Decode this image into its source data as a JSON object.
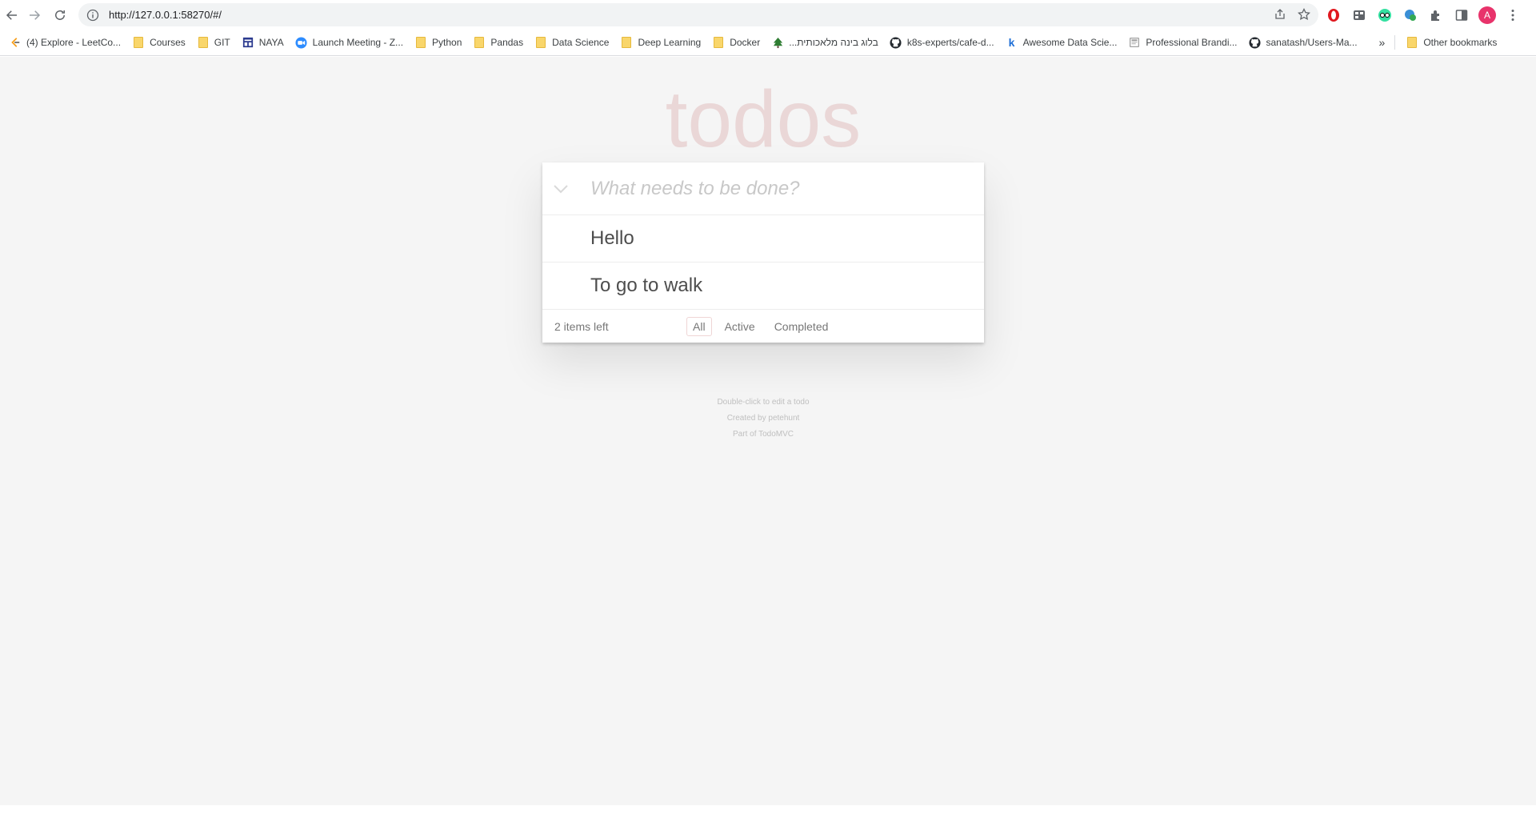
{
  "browser": {
    "url": "http://127.0.0.1:58270/#/",
    "avatar_letter": "A",
    "bookmarks": [
      {
        "label": "(4) Explore - LeetCo...",
        "icon": "leetcode-icon"
      },
      {
        "label": "Courses",
        "icon": "folder-icon"
      },
      {
        "label": "GIT",
        "icon": "folder-icon"
      },
      {
        "label": "NAYA",
        "icon": "naya-icon"
      },
      {
        "label": "Launch Meeting - Z...",
        "icon": "zoom-icon"
      },
      {
        "label": "Python",
        "icon": "folder-icon"
      },
      {
        "label": "Pandas",
        "icon": "folder-icon"
      },
      {
        "label": "Data Science",
        "icon": "folder-icon"
      },
      {
        "label": "Deep Learning",
        "icon": "folder-icon"
      },
      {
        "label": "Docker",
        "icon": "folder-icon"
      },
      {
        "label": "בלוג בינה מלאכותית...",
        "icon": "tree-icon"
      },
      {
        "label": "k8s-experts/cafe-d...",
        "icon": "github-icon"
      },
      {
        "label": "Awesome Data Scie...",
        "icon": "k-icon"
      },
      {
        "label": "Professional Brandi...",
        "icon": "doc-icon"
      },
      {
        "label": "sanatash/Users-Ma...",
        "icon": "github-icon"
      }
    ],
    "more_bookmarks": "»",
    "other_bookmarks": "Other bookmarks"
  },
  "app": {
    "title": "todos",
    "new_todo_placeholder": "What needs to be done?",
    "new_todo_value": "",
    "todos": [
      {
        "label": "Hello"
      },
      {
        "label": "To go to walk"
      }
    ],
    "count_text": "2 items left",
    "filters": {
      "all": "All",
      "active": "Active",
      "completed": "Completed"
    },
    "selected_filter": "All"
  },
  "info": {
    "line1": "Double-click to edit a todo",
    "line2": "Created by petehunt",
    "line3": "Part of TodoMVC"
  },
  "colors": {
    "page_background": "#f5f5f5",
    "title_color": "rgba(175, 47, 47, 0.15)",
    "avatar": "#e8336b"
  }
}
